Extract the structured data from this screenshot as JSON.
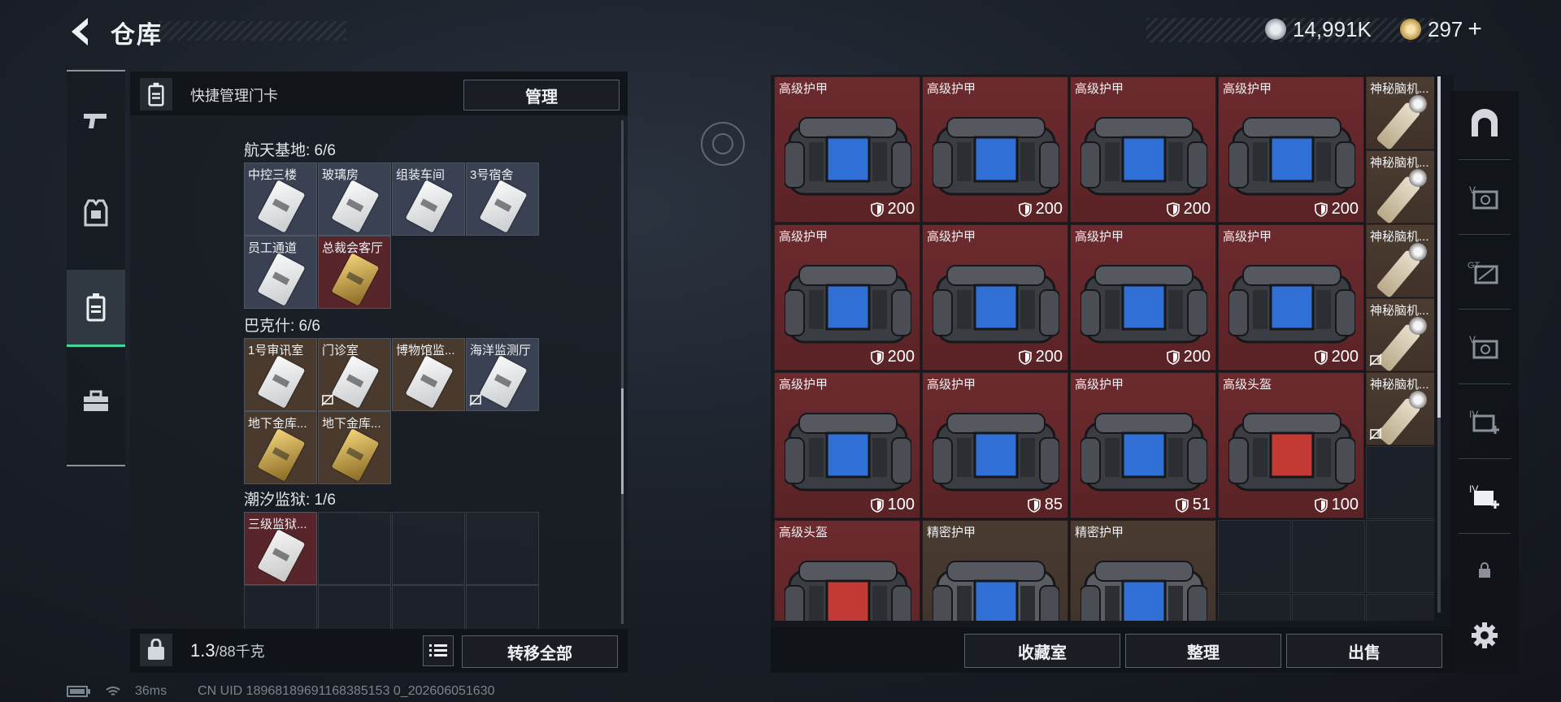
{
  "header": {
    "title": "仓库",
    "currency1": "14,991K",
    "currency2": "297",
    "plus": "+"
  },
  "left_panel": {
    "header_label": "快捷管理门卡",
    "manage_button": "管理",
    "sections": [
      {
        "title": "航天基地: 6/6",
        "cards": [
          {
            "name": "中控三楼",
            "style": "blue",
            "key": "w"
          },
          {
            "name": "玻璃房",
            "style": "blue",
            "key": "w"
          },
          {
            "name": "组装车间",
            "style": "blue",
            "key": "w"
          },
          {
            "name": "3号宿舍",
            "style": "blue",
            "key": "w"
          },
          {
            "name": "员工通道",
            "style": "blue",
            "key": "w"
          },
          {
            "name": "总裁会客厅",
            "style": "red",
            "key": "g"
          }
        ]
      },
      {
        "title": "巴克什: 6/6",
        "cards": [
          {
            "name": "1号审讯室",
            "style": "brown",
            "key": "w"
          },
          {
            "name": "门诊室",
            "style": "brown",
            "key": "w",
            "disabled": true
          },
          {
            "name": "博物馆监...",
            "style": "brown",
            "key": "w"
          },
          {
            "name": "海洋监测厅",
            "style": "blue",
            "key": "w",
            "disabled": true
          },
          {
            "name": "地下金库...",
            "style": "brown",
            "key": "g"
          },
          {
            "name": "地下金库...",
            "style": "brown",
            "key": "g"
          }
        ]
      },
      {
        "title": "潮汐监狱: 1/6",
        "cards": [
          {
            "name": "三级监狱...",
            "style": "red",
            "key": "r"
          }
        ]
      }
    ],
    "weight_value": "1.3",
    "weight_max": "/88千克",
    "transfer_button": "转移全部"
  },
  "right_panel": {
    "items": [
      {
        "name": "高级护甲",
        "value": "200",
        "type": "armor",
        "row": 0,
        "col": 0
      },
      {
        "name": "高级护甲",
        "value": "200",
        "type": "armor",
        "row": 0,
        "col": 1
      },
      {
        "name": "高级护甲",
        "value": "200",
        "type": "armor",
        "row": 0,
        "col": 2
      },
      {
        "name": "高级护甲",
        "value": "200",
        "type": "armor",
        "row": 0,
        "col": 3
      },
      {
        "name": "高级护甲",
        "value": "200",
        "type": "armor",
        "row": 1,
        "col": 0
      },
      {
        "name": "高级护甲",
        "value": "200",
        "type": "armor",
        "row": 1,
        "col": 1
      },
      {
        "name": "高级护甲",
        "value": "200",
        "type": "armor",
        "row": 1,
        "col": 2
      },
      {
        "name": "高级护甲",
        "value": "200",
        "type": "armor",
        "row": 1,
        "col": 3
      },
      {
        "name": "高级护甲",
        "value": "100",
        "type": "armor",
        "row": 2,
        "col": 0
      },
      {
        "name": "高级护甲",
        "value": "85",
        "type": "armor",
        "row": 2,
        "col": 1
      },
      {
        "name": "高级护甲",
        "value": "51",
        "type": "armor",
        "row": 2,
        "col": 2
      },
      {
        "name": "高级头盔",
        "value": "100",
        "type": "helmet",
        "row": 2,
        "col": 3
      },
      {
        "name": "高级头盔",
        "value": "",
        "type": "helmet",
        "row": 3,
        "col": 0
      },
      {
        "name": "精密护甲",
        "value": "",
        "type": "precise",
        "row": 3,
        "col": 1
      },
      {
        "name": "精密护甲",
        "value": "",
        "type": "precise",
        "row": 3,
        "col": 2
      }
    ],
    "narrow_items": [
      {
        "name": "神秘脑机...",
        "disabled": false
      },
      {
        "name": "神秘脑机...",
        "disabled": false
      },
      {
        "name": "神秘脑机...",
        "disabled": false
      },
      {
        "name": "神秘脑机...",
        "disabled": true
      },
      {
        "name": "神秘脑机...",
        "disabled": true
      }
    ],
    "buttons": [
      "收藏室",
      "整理",
      "出售"
    ]
  },
  "right_nav": {
    "labels": [
      "V",
      "GT",
      "V",
      "IV",
      "IV"
    ]
  },
  "status_bar": {
    "ping": "36ms",
    "uid": "CN UID 18968189691168385153 0_202606051630"
  },
  "colors": {
    "accent_green": "#44d59c",
    "item_red": "#6c2a2e",
    "item_brown": "#4a3b31"
  }
}
